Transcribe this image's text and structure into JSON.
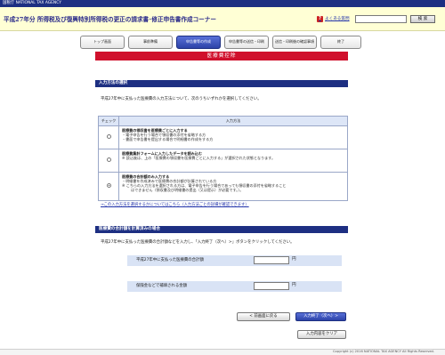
{
  "agency_bar": "国税庁 NATIONAL TAX AGENCY",
  "header": {
    "app_title": "平成27年分 所得税及び復興特別所得税の更正の請求書･修正申告書作成コーナー",
    "faq_label": "よくある質問",
    "search_value": "",
    "search_button": "検 索"
  },
  "steps": [
    {
      "label": "トップ画面",
      "active": false
    },
    {
      "label": "事前準備",
      "active": false
    },
    {
      "label": "申告書等の作成",
      "active": true
    },
    {
      "label": "申告書等の送信・印刷",
      "active": false
    },
    {
      "label": "送信・印刷後の確認事項",
      "active": false
    },
    {
      "label": "終了",
      "active": false
    }
  ],
  "page_heading": "医療費控除",
  "section1": {
    "title": "入力方法の選択",
    "description": "平成27年中に支払った医療費の入力方法について、次のうちいずれかを選択してください。"
  },
  "table": {
    "col_check": "チェック",
    "col_method": "入力方法",
    "rows": [
      {
        "selected": false,
        "title": "医療費の領収書を医療費ごとに入力する",
        "lines": [
          "・電子申告を行う場合で領収書の添付を省略する方",
          "・書面で申告書を提出する場合で明細書の作成をする方"
        ]
      },
      {
        "selected": false,
        "title": "医療費集計フォームに入力したデータを読み込む",
        "lines": [
          "※ 読込後は、上の「医療費の領収書を医療費ごとに入力する」が選択された状態となります。"
        ]
      },
      {
        "selected": true,
        "title": "医療費の合計額のみ入力する",
        "lines": [
          "・明細書を作成済みで医療費の合計額が計算されている方",
          "※ こちらの入力方法を選択される方は、電子申告を行う場合であっても領収書の添付を省略すること",
          "はできません（領収書及び明細書の提出（又は提示）が必要です。）。"
        ]
      }
    ]
  },
  "link_text": "→この入力方法を選択するかについてはこちら（入力方法ごとの詳細が確認できます）",
  "section2": {
    "title": "医療費の合計額を計算済みの場合",
    "description": "平成27年中に支払った医療費の合計額などを入力し、「入力終了（次へ）>」ボタンをクリックしてください。"
  },
  "fields": [
    {
      "label": "平成27年中に支払った医療費の合計額",
      "value": "",
      "unit": "円"
    },
    {
      "label": "保険金などで補填される金額",
      "value": "",
      "unit": "円"
    }
  ],
  "buttons": {
    "back": "< 前画面に戻る",
    "next": "入力終了（次へ）>",
    "clear": "入力内容をクリア"
  },
  "footer": "Copyright (c) 2016 NATIONAL TAX AGENCY All Rights Reserved.",
  "colors": {
    "navy": "#1d2f82",
    "heading_red": "#d0102c",
    "header_bg": "#ffffd5",
    "field_bg": "#d9e3f5"
  }
}
